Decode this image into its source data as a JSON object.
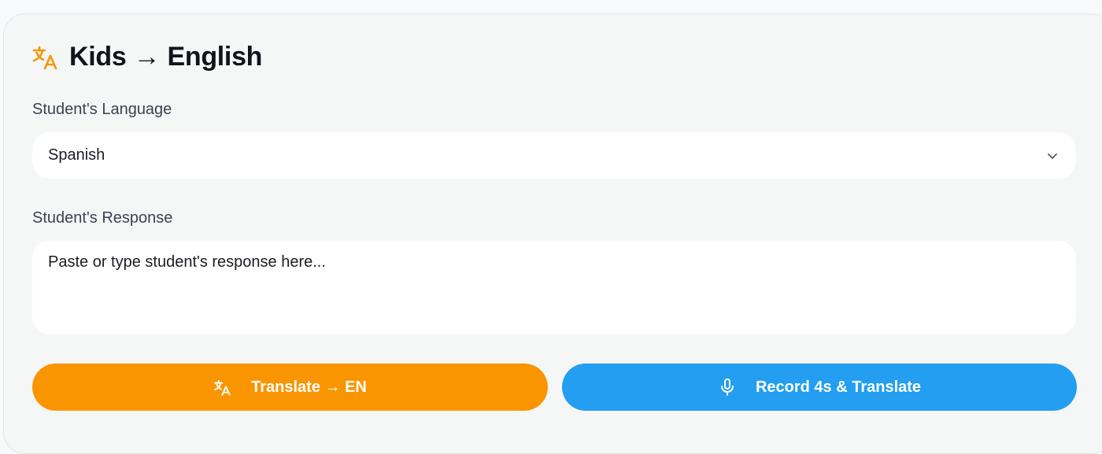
{
  "header": {
    "title": "Kids → English",
    "icon": "translate-icon",
    "accent_color": "#f99500"
  },
  "language_field": {
    "label": "Student's Language",
    "selected_value": "Spanish",
    "icon": "chevron-down-icon"
  },
  "response_field": {
    "label": "Student's Response",
    "placeholder": "Paste or type student's response here..."
  },
  "buttons": {
    "translate": {
      "label": "Translate → EN",
      "icon": "translate-icon",
      "color": "#f99500"
    },
    "record": {
      "label": "Record 4s & Translate",
      "icon": "microphone-icon",
      "color": "#239ef0"
    }
  }
}
